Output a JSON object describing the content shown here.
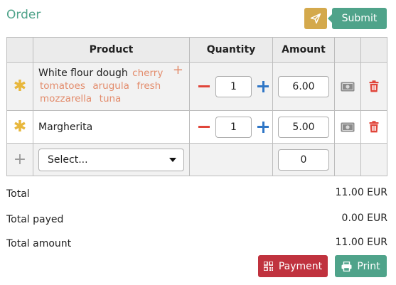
{
  "header": {
    "title": "Order",
    "submit_label": "Submit",
    "send_icon": "paper-plane-icon"
  },
  "table": {
    "columns": [
      "",
      "Product",
      "Quantity",
      "Amount",
      "",
      ""
    ],
    "rows": [
      {
        "product": "White flour dough",
        "toppings": [
          "cherry",
          "tomatoes",
          "arugula",
          "fresh",
          "mozzarella",
          "tuna"
        ],
        "quantity": "1",
        "amount": "6.00"
      },
      {
        "product": "Margherita",
        "toppings": [],
        "quantity": "1",
        "amount": "5.00"
      }
    ],
    "new_row": {
      "select_placeholder": "Select...",
      "amount": "0"
    }
  },
  "totals": [
    {
      "label": "Total",
      "value": "11.00 EUR"
    },
    {
      "label": "Total payed",
      "value": "0.00 EUR"
    },
    {
      "label": "Total amount",
      "value": "11.00 EUR"
    }
  ],
  "footer": {
    "payment_label": "Payment",
    "print_label": "Print"
  },
  "colors": {
    "accent": "#4fa38a",
    "send": "#d4a94c",
    "danger": "#c0323e",
    "topping": "#e38c6c",
    "plus": "#2f76c6",
    "minus": "#e0453a",
    "star": "#e8b73c"
  }
}
